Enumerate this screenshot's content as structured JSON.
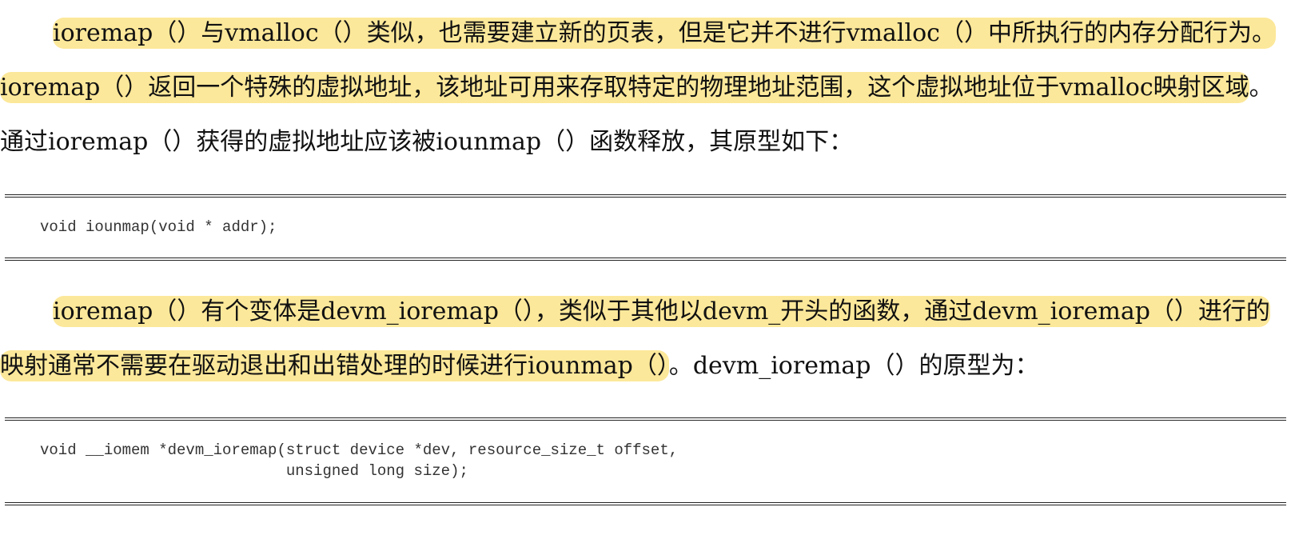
{
  "colors": {
    "highlight": "#fce89a",
    "text": "#111111",
    "code_text": "#333333"
  },
  "paragraph1": {
    "seg1": "ioremap（）与vmalloc（）类似，也需要建立新的页表，但是它并不进行vmalloc（）中所执行的内存分配行为。ioremap（）返回一个特殊的虚拟地址，该地址可用来存取特定的物理地址范围，这个虚拟地址位于vmalloc映射区域",
    "seg2": "。通过ioremap（）获得的虚拟地址应该被iounmap（）函数释放，其原型如下："
  },
  "code_block1": {
    "line1": "void iounmap(void * addr);"
  },
  "paragraph2": {
    "seg1": "ioremap（）有个变体是devm_ioremap（），类似于其他以devm_开头的函数，通过devm_ioremap（）进行的映射通常不需要在驱动退出和出错处理的时候进行iounmap（）",
    "seg2": "。devm_ioremap（）的原型为："
  },
  "code_block2": {
    "line1": "void __iomem *devm_ioremap(struct device *dev, resource_size_t offset,",
    "line2": "                           unsigned long size);"
  }
}
